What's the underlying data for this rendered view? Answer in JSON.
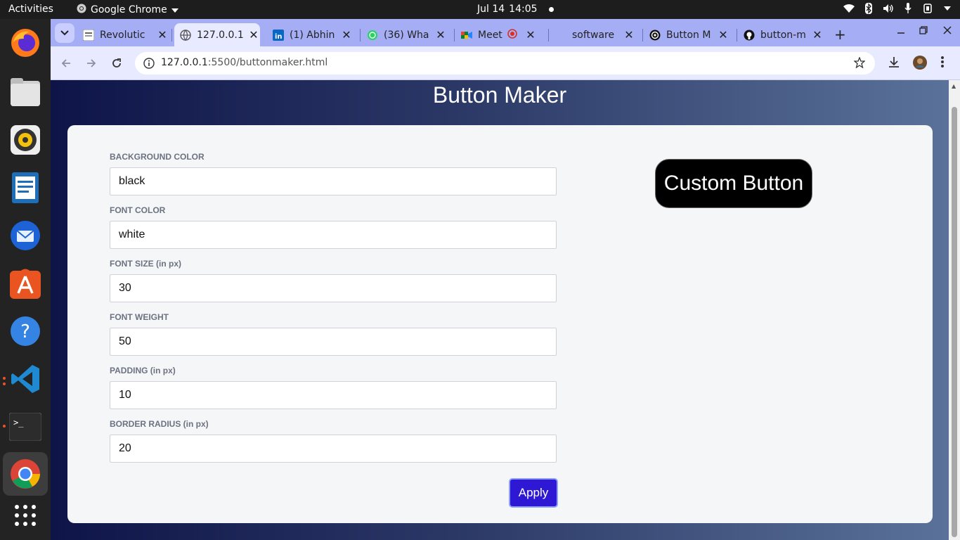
{
  "system": {
    "activities": "Activities",
    "app_name": "Google Chrome",
    "date": "Jul 14",
    "time": "14:05"
  },
  "dock": {
    "items": [
      "firefox-icon",
      "files-icon",
      "rhythmbox-icon",
      "writer-icon",
      "thunderbird-icon",
      "app-center-icon",
      "help-icon",
      "vscode-icon",
      "terminal-icon",
      "chrome-icon",
      "app-grid-icon"
    ]
  },
  "tabs": [
    {
      "title": "Revolutic",
      "icon": "news-icon"
    },
    {
      "title": "127.0.0.1",
      "icon": "globe-icon",
      "active": true
    },
    {
      "title": "(1) Abhin",
      "icon": "linkedin-icon"
    },
    {
      "title": "(36) Wha",
      "icon": "whatsapp-icon"
    },
    {
      "title": "Meet -",
      "icon": "meet-icon"
    },
    {
      "title": "software",
      "icon": "blank-icon"
    },
    {
      "title": "Button M",
      "icon": "chatgpt-icon"
    },
    {
      "title": "button-m",
      "icon": "github-icon"
    }
  ],
  "address": {
    "host": "127.0.0.1",
    "path": ":5500/buttonmaker.html"
  },
  "page": {
    "title": "Button Maker",
    "fields": [
      {
        "label": "BACKGROUND COLOR",
        "value": "black"
      },
      {
        "label": "FONT COLOR",
        "value": "white"
      },
      {
        "label": "FONT SIZE (in px)",
        "value": "30"
      },
      {
        "label": "FONT WEIGHT",
        "value": "50"
      },
      {
        "label": "PADDING (in px)",
        "value": "10"
      },
      {
        "label": "BORDER RADIUS (in px)",
        "value": "20"
      }
    ],
    "apply_label": "Apply",
    "preview_label": "Custom Button"
  },
  "colors": {
    "accent": "#2f18d4",
    "tabstrip": "#a5aef5",
    "preview_bg": "#000000",
    "preview_fg": "#ffffff"
  }
}
